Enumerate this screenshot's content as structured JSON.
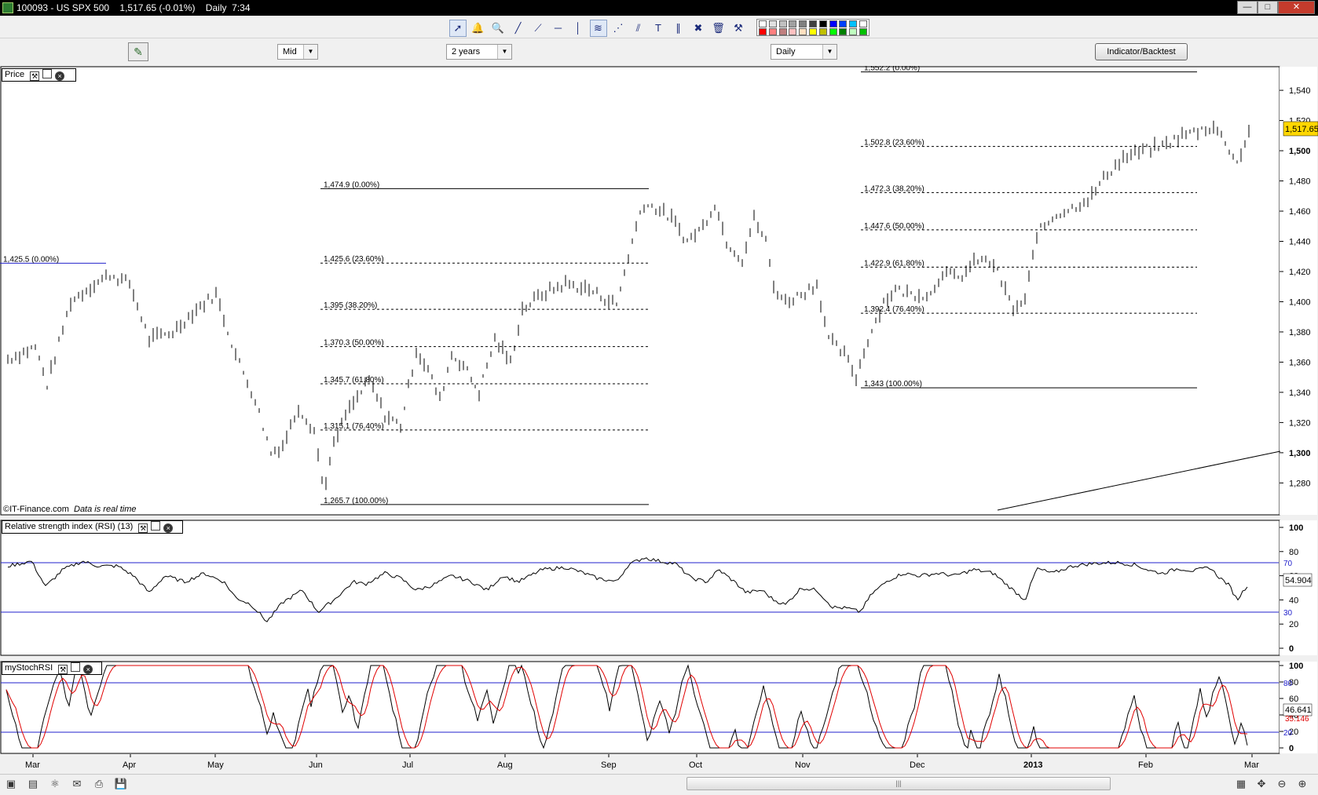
{
  "window": {
    "title": "100093 - US SPX 500    1,517.65 (-0.01%)    Daily  7:34",
    "controls": [
      "—",
      "□",
      "✕"
    ]
  },
  "toolbar": {
    "icons": [
      "select-arrow-icon",
      "alert-bell-icon",
      "zoom-icon",
      "trendline-icon",
      "ray-icon",
      "horizontal-line-icon",
      "vertical-line-icon",
      "fibonacci-icon",
      "fan-icon",
      "channel-icon",
      "text-icon",
      "parallel-icon",
      "delete-object-icon",
      "trash-icon",
      "tools-icon"
    ],
    "palette": [
      "#ffffff",
      "#e0e0e0",
      "#c0c0c0",
      "#a0a0a0",
      "#808080",
      "#404040",
      "#000000",
      "#0000ff",
      "#0040ff",
      "#00c0ff",
      "#ffffff",
      "#ff0000",
      "#ff8080",
      "#c08080",
      "#ffc0c0",
      "#ffe0c0",
      "#ffff00",
      "#c0c000",
      "#00ff00",
      "#008000",
      "#c0ffc0",
      "#00c000"
    ]
  },
  "controls": {
    "mid": "Mid",
    "range": "2 years",
    "interval": "Daily",
    "indicator_button": "Indicator/Backtest"
  },
  "price_panel": {
    "label": "Price",
    "copyright": "©IT-Finance.com",
    "realtime": "Data is real time",
    "last_price": "1,517.65",
    "yticks": [
      "1,540",
      "1,520",
      "1,500",
      "1,480",
      "1,460",
      "1,440",
      "1,420",
      "1,400",
      "1,380",
      "1,360",
      "1,340",
      "1,320",
      "1,300",
      "1,280"
    ],
    "yrange": [
      1262,
      1552
    ],
    "fib_sets": [
      {
        "x_from": 0,
        "x_to": 135,
        "levels": [
          [
            "1,425.5 (0.00%)",
            1425.5
          ]
        ]
      },
      {
        "x_from": 408,
        "x_to": 826,
        "levels": [
          [
            "1,474.9 (0.00%)",
            1474.9
          ],
          [
            "1,425.6 (23.60%)",
            1425.6
          ],
          [
            "1,395 (38.20%)",
            1395
          ],
          [
            "1,370.3 (50.00%)",
            1370.3
          ],
          [
            "1,345.7 (61.80%)",
            1345.7
          ],
          [
            "1,315.1 (76.40%)",
            1315.1
          ],
          [
            "1,265.7 (100.00%)",
            1265.7
          ]
        ]
      },
      {
        "x_from": 1096,
        "x_to": 1524,
        "levels": [
          [
            "1,552.2 (0.00%)",
            1552.2
          ],
          [
            "1,502.8 (23.60%)",
            1502.8
          ],
          [
            "1,472.3 (38.20%)",
            1472.3
          ],
          [
            "1,447.6 (50.00%)",
            1447.6
          ],
          [
            "1,422.9 (61.80%)",
            1422.9
          ],
          [
            "1,392.4 (76.40%)",
            1392.4
          ],
          [
            "1,343 (100.00%)",
            1343
          ]
        ]
      }
    ],
    "series_anchors": [
      [
        10,
        1362
      ],
      [
        45,
        1370
      ],
      [
        60,
        1345
      ],
      [
        90,
        1400
      ],
      [
        115,
        1410
      ],
      [
        140,
        1418
      ],
      [
        165,
        1412
      ],
      [
        190,
        1375
      ],
      [
        220,
        1380
      ],
      [
        250,
        1395
      ],
      [
        275,
        1405
      ],
      [
        300,
        1365
      ],
      [
        325,
        1335
      ],
      [
        345,
        1300
      ],
      [
        360,
        1305
      ],
      [
        380,
        1330
      ],
      [
        400,
        1315
      ],
      [
        412,
        1275
      ],
      [
        425,
        1305
      ],
      [
        440,
        1325
      ],
      [
        470,
        1348
      ],
      [
        490,
        1325
      ],
      [
        510,
        1318
      ],
      [
        530,
        1368
      ],
      [
        545,
        1355
      ],
      [
        560,
        1335
      ],
      [
        575,
        1365
      ],
      [
        590,
        1358
      ],
      [
        610,
        1340
      ],
      [
        630,
        1375
      ],
      [
        650,
        1360
      ],
      [
        665,
        1395
      ],
      [
        690,
        1405
      ],
      [
        720,
        1412
      ],
      [
        750,
        1408
      ],
      [
        785,
        1398
      ],
      [
        800,
        1430
      ],
      [
        818,
        1465
      ],
      [
        835,
        1462
      ],
      [
        855,
        1455
      ],
      [
        875,
        1440
      ],
      [
        895,
        1450
      ],
      [
        910,
        1465
      ],
      [
        925,
        1440
      ],
      [
        945,
        1428
      ],
      [
        960,
        1455
      ],
      [
        975,
        1440
      ],
      [
        985,
        1410
      ],
      [
        1000,
        1400
      ],
      [
        1020,
        1405
      ],
      [
        1040,
        1412
      ],
      [
        1055,
        1375
      ],
      [
        1075,
        1365
      ],
      [
        1090,
        1350
      ],
      [
        1105,
        1375
      ],
      [
        1125,
        1400
      ],
      [
        1140,
        1408
      ],
      [
        1160,
        1405
      ],
      [
        1185,
        1405
      ],
      [
        1200,
        1420
      ],
      [
        1220,
        1415
      ],
      [
        1245,
        1428
      ],
      [
        1265,
        1425
      ],
      [
        1290,
        1395
      ],
      [
        1305,
        1400
      ],
      [
        1320,
        1445
      ],
      [
        1345,
        1458
      ],
      [
        1365,
        1462
      ],
      [
        1390,
        1470
      ],
      [
        1410,
        1485
      ],
      [
        1430,
        1495
      ],
      [
        1455,
        1500
      ],
      [
        1480,
        1503
      ],
      [
        1505,
        1510
      ],
      [
        1530,
        1514
      ],
      [
        1545,
        1516
      ],
      [
        1560,
        1506
      ],
      [
        1575,
        1492
      ],
      [
        1590,
        1512
      ]
    ],
    "trendline": [
      [
        1270,
        1262
      ],
      [
        1630,
        1301
      ]
    ]
  },
  "rsi_panel": {
    "label": "Relative strength index (RSI) (13)",
    "value": "54.904",
    "levels": [
      "70",
      "30"
    ],
    "yticks": [
      "100",
      "80",
      "60",
      "40",
      "20",
      "0"
    ],
    "anchors": [
      [
        10,
        68
      ],
      [
        40,
        72
      ],
      [
        58,
        51
      ],
      [
        80,
        65
      ],
      [
        105,
        72
      ],
      [
        125,
        68
      ],
      [
        150,
        68
      ],
      [
        170,
        60
      ],
      [
        190,
        46
      ],
      [
        210,
        60
      ],
      [
        235,
        55
      ],
      [
        260,
        62
      ],
      [
        285,
        55
      ],
      [
        300,
        42
      ],
      [
        320,
        36
      ],
      [
        340,
        22
      ],
      [
        360,
        38
      ],
      [
        385,
        48
      ],
      [
        405,
        30
      ],
      [
        425,
        40
      ],
      [
        450,
        55
      ],
      [
        465,
        53
      ],
      [
        490,
        62
      ],
      [
        510,
        58
      ],
      [
        530,
        48
      ],
      [
        550,
        52
      ],
      [
        575,
        60
      ],
      [
        600,
        55
      ],
      [
        620,
        48
      ],
      [
        640,
        60
      ],
      [
        660,
        55
      ],
      [
        690,
        65
      ],
      [
        720,
        67
      ],
      [
        740,
        63
      ],
      [
        760,
        58
      ],
      [
        785,
        55
      ],
      [
        800,
        69
      ],
      [
        820,
        75
      ],
      [
        840,
        72
      ],
      [
        860,
        70
      ],
      [
        880,
        58
      ],
      [
        900,
        55
      ],
      [
        915,
        65
      ],
      [
        935,
        55
      ],
      [
        950,
        46
      ],
      [
        970,
        48
      ],
      [
        985,
        40
      ],
      [
        1000,
        36
      ],
      [
        1020,
        50
      ],
      [
        1040,
        48
      ],
      [
        1060,
        34
      ],
      [
        1080,
        33
      ],
      [
        1095,
        30
      ],
      [
        1110,
        45
      ],
      [
        1130,
        56
      ],
      [
        1150,
        62
      ],
      [
        1170,
        60
      ],
      [
        1195,
        62
      ],
      [
        1215,
        60
      ],
      [
        1240,
        65
      ],
      [
        1265,
        62
      ],
      [
        1290,
        48
      ],
      [
        1305,
        40
      ],
      [
        1320,
        66
      ],
      [
        1340,
        62
      ],
      [
        1365,
        68
      ],
      [
        1390,
        70
      ],
      [
        1420,
        71
      ],
      [
        1445,
        69
      ],
      [
        1465,
        64
      ],
      [
        1480,
        62
      ],
      [
        1500,
        66
      ],
      [
        1520,
        64
      ],
      [
        1540,
        67
      ],
      [
        1550,
        60
      ],
      [
        1565,
        52
      ],
      [
        1575,
        40
      ],
      [
        1590,
        54
      ]
    ]
  },
  "stoch_panel": {
    "label": "myStochRSI",
    "value": "46.641",
    "value2": "35.146",
    "levels": [
      "80",
      "20"
    ],
    "yticks": [
      "100",
      "80",
      "60",
      "40",
      "20",
      "0"
    ]
  },
  "xaxis": {
    "labels": [
      [
        "Mar",
        42
      ],
      [
        "Apr",
        166
      ],
      [
        "May",
        274
      ],
      [
        "Jun",
        403
      ],
      [
        "Jul",
        522
      ],
      [
        "Aug",
        643
      ],
      [
        "Sep",
        775
      ],
      [
        "Oct",
        887
      ],
      [
        "Nov",
        1022
      ],
      [
        "Dec",
        1168
      ],
      [
        "2013",
        1313
      ],
      [
        "Feb",
        1459
      ],
      [
        "Mar",
        1594
      ]
    ],
    "bold": "2013"
  },
  "bottom_icons": [
    "desktop-icon",
    "chart-icon",
    "network-icon",
    "mail-icon",
    "print-icon",
    "save-icon"
  ],
  "zoom_icons": [
    "grid-icon",
    "move-icon",
    "zoom-out-icon",
    "zoom-in-icon"
  ]
}
